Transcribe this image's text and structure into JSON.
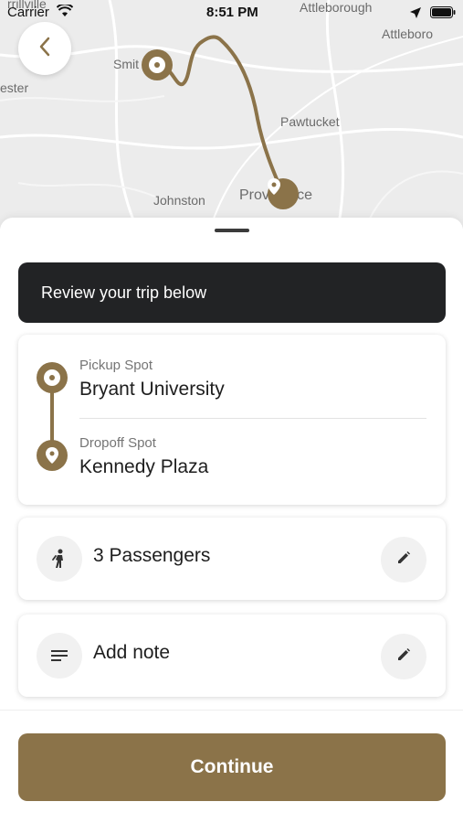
{
  "status_bar": {
    "carrier": "Carrier",
    "time": "8:51 PM"
  },
  "map": {
    "labels": [
      "rrillville",
      "Attleborough",
      "Attleboro",
      "Smit",
      "ester",
      "Pawtucket",
      "Johnston",
      "Providence"
    ],
    "route_color": "#8b7349"
  },
  "icons": {
    "back": "chevron-left-icon",
    "pickup": "pickup-pin-icon",
    "dropoff": "dropoff-pin-icon",
    "passengers": "person-icon",
    "note": "notes-lines-icon",
    "edit": "pencil-icon"
  },
  "banner": {
    "text": "Review your trip below"
  },
  "trip": {
    "pickup_label": "Pickup Spot",
    "pickup_value": "Bryant University",
    "dropoff_label": "Dropoff Spot",
    "dropoff_value": "Kennedy Plaza"
  },
  "passengers": {
    "label": "3 Passengers"
  },
  "note": {
    "label": "Add note"
  },
  "actions": {
    "continue_label": "Continue"
  },
  "colors": {
    "accent": "#8b7349",
    "banner_bg": "#222325"
  }
}
